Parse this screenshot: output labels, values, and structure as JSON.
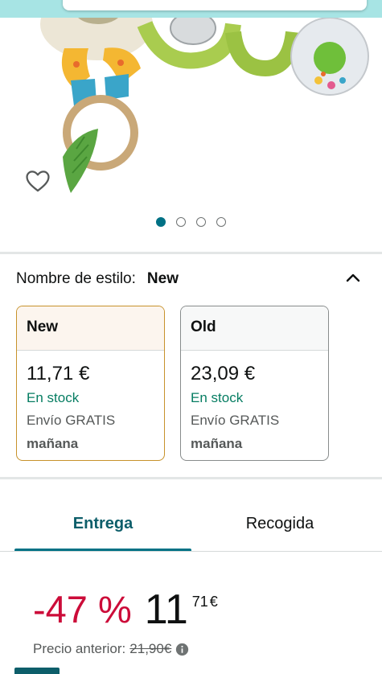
{
  "gallery": {
    "image_alt": "",
    "dot_count": 4,
    "active_dot": 0
  },
  "style": {
    "label": "Nombre de estilo:",
    "selected": "New",
    "options": [
      {
        "name": "New",
        "price": "11,71 €",
        "stock": "En stock",
        "shipping": "Envío GRATIS",
        "date": "mañana",
        "selected": true
      },
      {
        "name": "Old",
        "price": "23,09 €",
        "stock": "En stock",
        "shipping": "Envío GRATIS",
        "date": "mañana",
        "selected": false
      }
    ]
  },
  "tabs": [
    {
      "label": "Entrega",
      "active": true
    },
    {
      "label": "Recogida",
      "active": false
    }
  ],
  "price": {
    "discount": "-47 %",
    "whole": "11",
    "fraction": "71",
    "currency": "€",
    "previous_label": "Precio anterior:",
    "previous_value": "21,90€"
  },
  "colors": {
    "accent_teal": "#007185",
    "selected_border": "#c7922b",
    "discount_red": "#cc0c39",
    "stock_green": "#067d62"
  },
  "icons": {
    "wishlist": "heart-outline-icon",
    "collapse": "chevron-up-icon",
    "info": "info-circle-icon"
  }
}
